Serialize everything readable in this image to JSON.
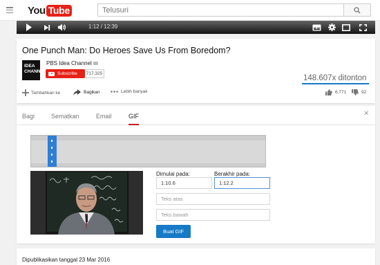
{
  "masthead": {
    "logo_you": "You",
    "logo_tube": "Tube",
    "search_placeholder": "Telusuri"
  },
  "player": {
    "time": "1:12 / 12:39"
  },
  "video": {
    "title": "One Punch Man: Do Heroes Save Us From Boredom?",
    "channel_logo_text": "IDEA CHANNEL",
    "channel_name": "PBS Idea Channel",
    "subscribe_label": "Subscribe",
    "subscriber_count": "717.325",
    "views": "148.607x ditonton",
    "actions": {
      "add_to": "Tambahkan ke",
      "share": "Bagikan",
      "more": "Lebih banyak"
    },
    "likes": "6.771",
    "dislikes": "92"
  },
  "share_panel": {
    "tabs": [
      "Bagi",
      "Sematkan",
      "Email",
      "GIF"
    ],
    "active_tab": "GIF",
    "start_label": "Dimulai pada:",
    "start_value": "1:10.6",
    "end_label": "Berakhir pada:",
    "end_value": "1:12.2",
    "top_text_placeholder": "Teks atas",
    "bottom_text_placeholder": "Teks bawah",
    "create_button": "Buat GIF"
  },
  "published": "Dipublikasikan tanggal 23 Mar 2016",
  "colors": {
    "brand_red": "#e62117",
    "accent_blue": "#167ac6",
    "tab_underline": "#cc181e"
  }
}
